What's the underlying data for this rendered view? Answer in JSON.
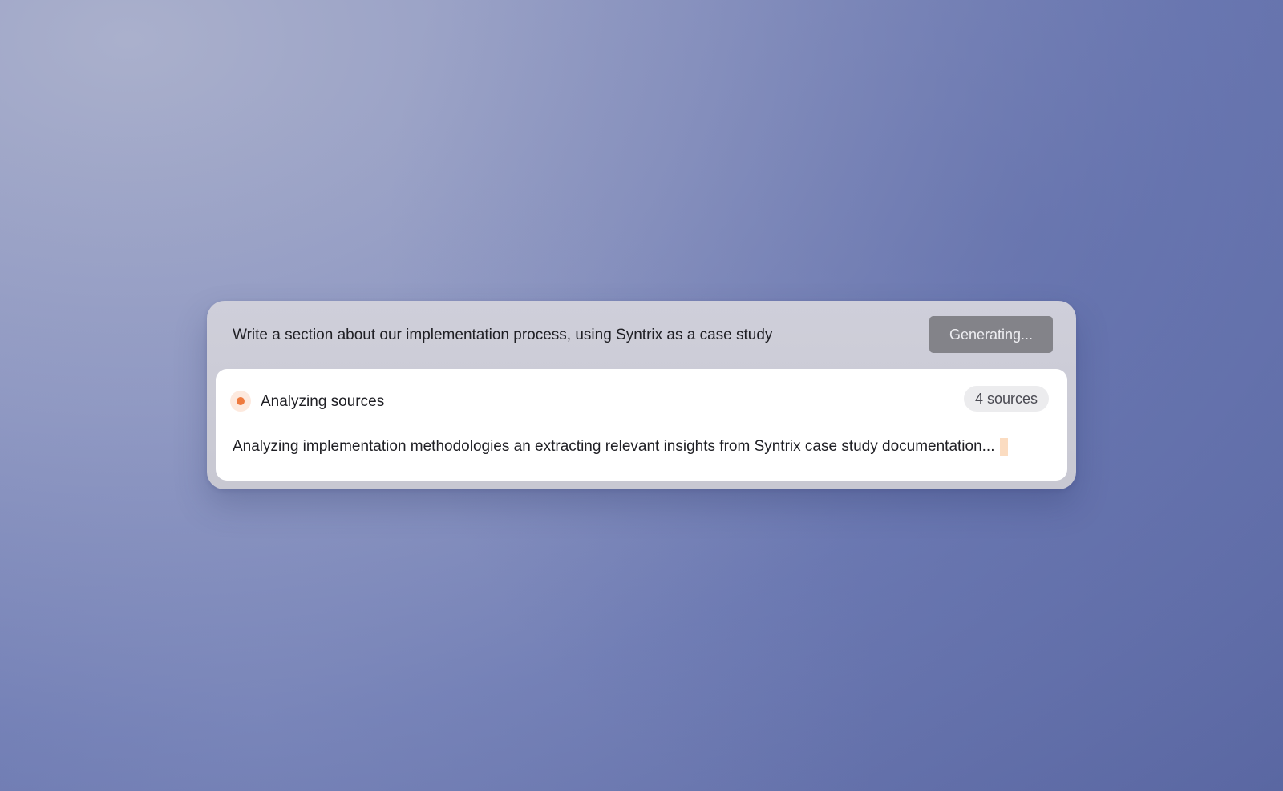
{
  "prompt": {
    "text": "Write a section about our implementation process, using Syntrix as a case study",
    "button_label": "Generating..."
  },
  "status": {
    "label": "Analyzing sources",
    "sources_badge": "4 sources",
    "dot_color": "#ee7a3f",
    "progress_text": "Analyzing implementation methodologies an extracting relevant insights from Syntrix case study documentation..."
  },
  "colors": {
    "background": "#6f7cb4",
    "card": "#cbcbd5",
    "button": "#838389",
    "cursor": "#fbdcc1"
  }
}
